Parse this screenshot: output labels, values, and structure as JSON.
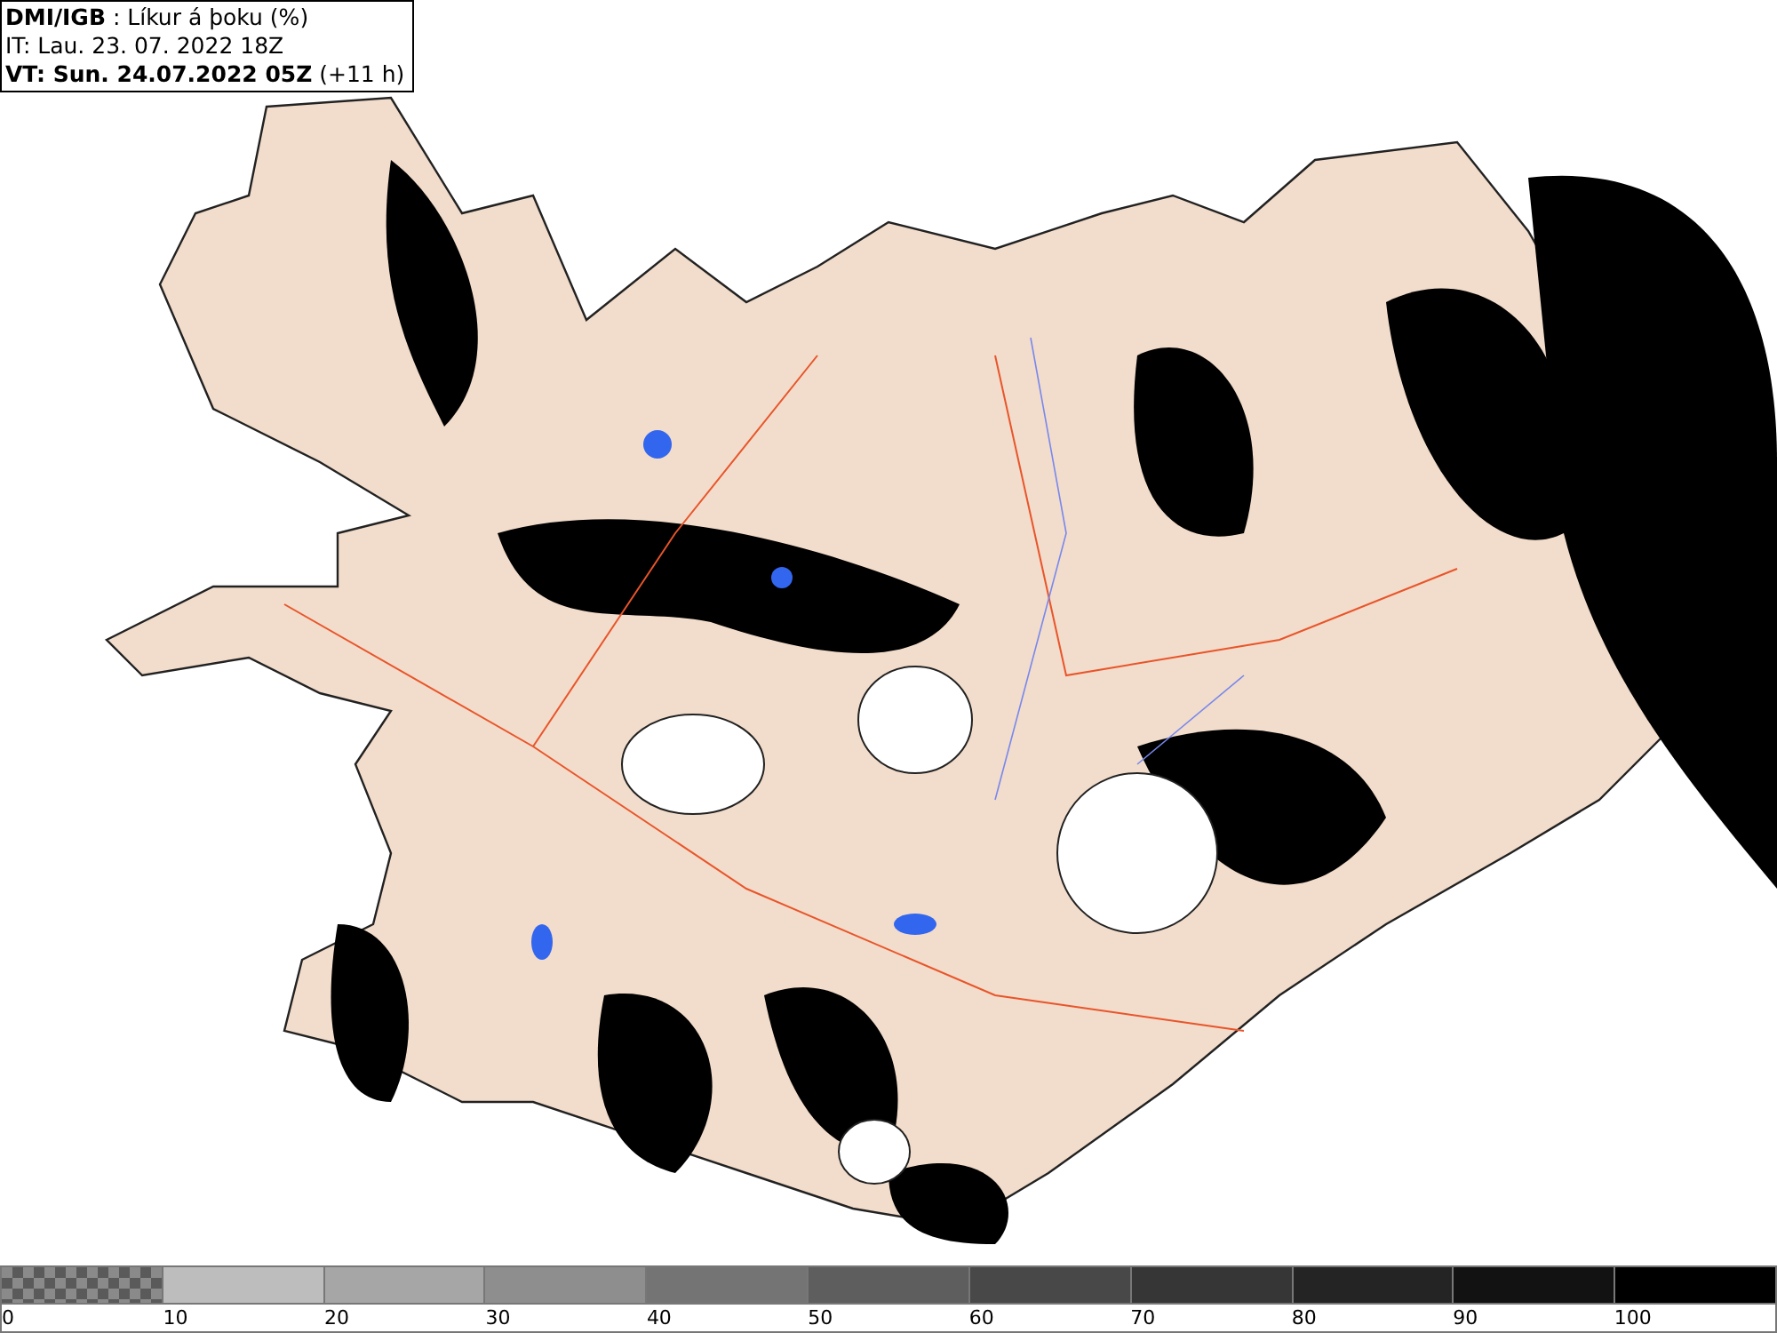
{
  "header": {
    "source": "DMI/IGB",
    "product": " : Líkur á þoku (%)",
    "issue_time": "IT: Lau. 23. 07. 2022 18Z",
    "valid_time": "VT: Sun. 24.07.2022 05Z",
    "lead": " (+11 h)"
  },
  "legend": {
    "bins": [
      {
        "kind": "checkered",
        "color": "#5a5a5a",
        "label": "0"
      },
      {
        "kind": "solid",
        "color": "#bdbdbd",
        "label": "10"
      },
      {
        "kind": "solid",
        "color": "#a6a6a6",
        "label": "20"
      },
      {
        "kind": "solid",
        "color": "#8e8e8e",
        "label": "30"
      },
      {
        "kind": "solid",
        "color": "#747474",
        "label": "40"
      },
      {
        "kind": "solid",
        "color": "#5e5e5e",
        "label": "50"
      },
      {
        "kind": "solid",
        "color": "#484848",
        "label": "60"
      },
      {
        "kind": "solid",
        "color": "#363636",
        "label": "70"
      },
      {
        "kind": "solid",
        "color": "#242424",
        "label": "80"
      },
      {
        "kind": "solid",
        "color": "#121212",
        "label": "90"
      },
      {
        "kind": "solid",
        "color": "#000000",
        "label": "100"
      }
    ]
  }
}
